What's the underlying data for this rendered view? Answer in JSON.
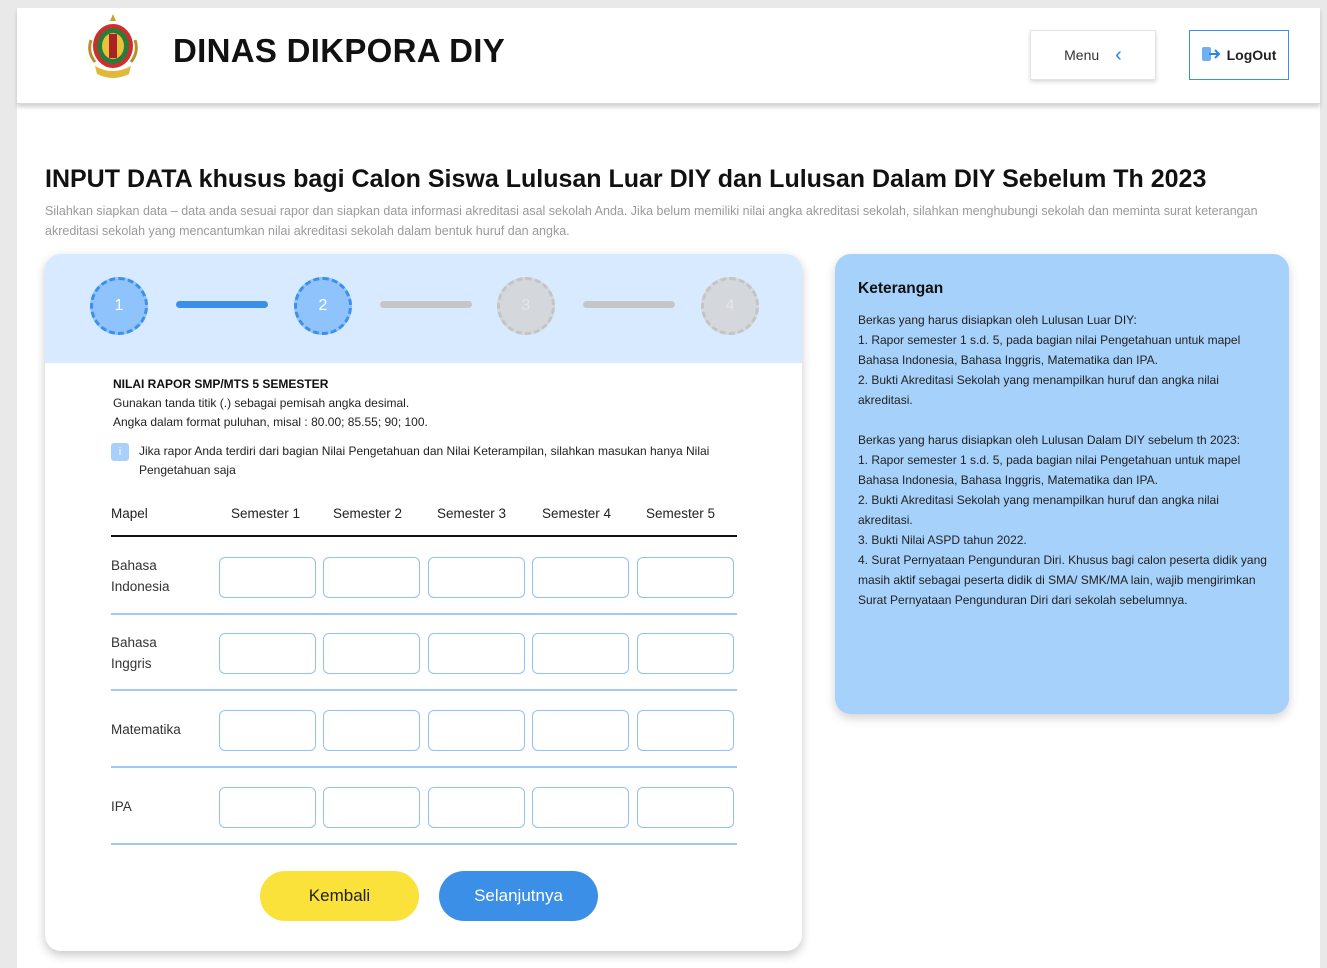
{
  "header": {
    "brand": "DINAS DIKPORA DIY",
    "menu_label": "Menu",
    "logout_label": "LogOut"
  },
  "page": {
    "title": "INPUT DATA khusus bagi Calon Siswa Lulusan Luar DIY dan Lulusan Dalam DIY Sebelum Th 2023",
    "subtitle": "Silahkan siapkan data – data anda sesuai rapor dan siapkan data informasi akreditasi asal sekolah Anda. Jika belum memiliki nilai angka akreditasi sekolah, silahkan menghubungi sekolah dan meminta surat keterangan akreditasi sekolah yang mencantumkan nilai akreditasi sekolah dalam bentuk huruf dan angka."
  },
  "stepper": {
    "steps": [
      "1",
      "2",
      "3",
      "4"
    ],
    "active_count": 2
  },
  "form": {
    "heading": "NILAI RAPOR SMP/MTS 5 SEMESTER",
    "hint1": "Gunakan tanda titik (.) sebagai pemisah angka desimal.",
    "hint2": "Angka dalam format puluhan, misal : 80.00; 85.55; 90; 100.",
    "info_icon": "i",
    "info_text": "Jika rapor Anda terdiri dari bagian Nilai Pengetahuan dan Nilai Keterampilan, silahkan masukan hanya Nilai Pengetahuan saja",
    "columns": [
      "Mapel",
      "Semester 1",
      "Semester 2",
      "Semester 3",
      "Semester 4",
      "Semester 5"
    ],
    "rows": [
      {
        "mapel_line1": "Bahasa",
        "mapel_line2": "Indonesia"
      },
      {
        "mapel_line1": "Bahasa",
        "mapel_line2": "Inggris"
      },
      {
        "mapel_line1": "Matematika",
        "mapel_line2": ""
      },
      {
        "mapel_line1": "IPA",
        "mapel_line2": ""
      }
    ],
    "back_label": "Kembali",
    "next_label": "Selanjutnya"
  },
  "keterangan": {
    "title": "Keterangan",
    "luar_intro": "Berkas yang harus disiapkan oleh Lulusan Luar DIY:",
    "luar_items": [
      "1. Rapor semester 1 s.d. 5, pada bagian nilai Pengetahuan untuk mapel Bahasa Indonesia, Bahasa Inggris, Matematika dan IPA.",
      "2. Bukti Akreditasi Sekolah yang menampilkan huruf dan angka nilai akreditasi."
    ],
    "dalam_intro": "Berkas yang harus disiapkan oleh Lulusan Dalam DIY sebelum th 2023:",
    "dalam_items": [
      "1. Rapor semester 1 s.d. 5, pada bagian nilai Pengetahuan untuk mapel Bahasa Indonesia, Bahasa Inggris, Matematika dan IPA.",
      "2. Bukti Akreditasi Sekolah yang menampilkan huruf dan angka nilai akreditasi.",
      "3. Bukti Nilai ASPD tahun 2022.",
      "4. Surat Pernyataan Pengunduran Diri. Khusus bagi calon peserta didik yang masih aktif sebagai peserta didik di SMA/ SMK/MA lain, wajib mengirimkan Surat Pernyataan Pengunduran Diri dari sekolah sebelumnya."
    ]
  },
  "colors": {
    "primary": "#3b8fe6",
    "back_button": "#fbe23a",
    "panel": "#a6d1fb",
    "stepper_band": "#d8eaff"
  }
}
